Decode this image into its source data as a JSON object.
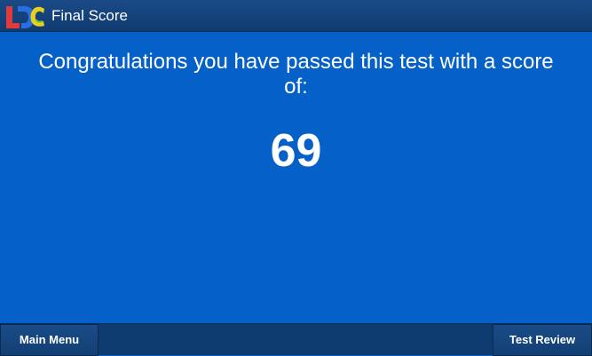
{
  "header": {
    "title": "Final Score"
  },
  "main": {
    "message": "Congratulations you have passed this test with a score of:",
    "score": "69"
  },
  "footer": {
    "main_menu_label": "Main Menu",
    "test_review_label": "Test Review"
  },
  "colors": {
    "background": "#0560c8",
    "bars": "#0f3b70",
    "text": "#ffffff"
  }
}
